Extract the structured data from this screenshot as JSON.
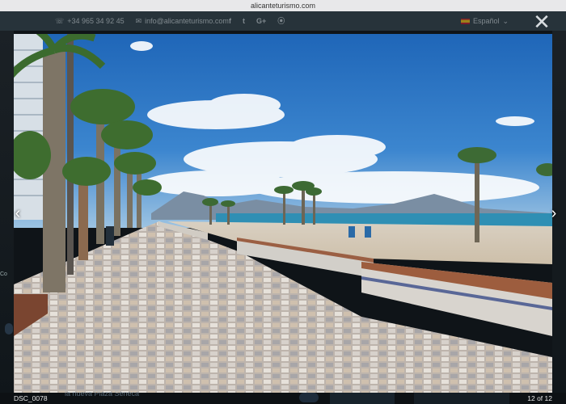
{
  "browser": {
    "url": "alicanteturismo.com"
  },
  "header": {
    "phone": "+34 965 34 92 45",
    "email": "info@alicanteturismo.com",
    "social": [
      "f",
      "t",
      "G+",
      "rss"
    ],
    "language": "Español"
  },
  "background_page": {
    "left_fragment": "Co",
    "caption_fragment": "la nueva Plaza Séneca"
  },
  "lightbox": {
    "close_symbol": "✕",
    "prev_symbol": "‹",
    "next_symbol": "›",
    "caption": "DSC_0078",
    "counter": "12 of 12"
  }
}
